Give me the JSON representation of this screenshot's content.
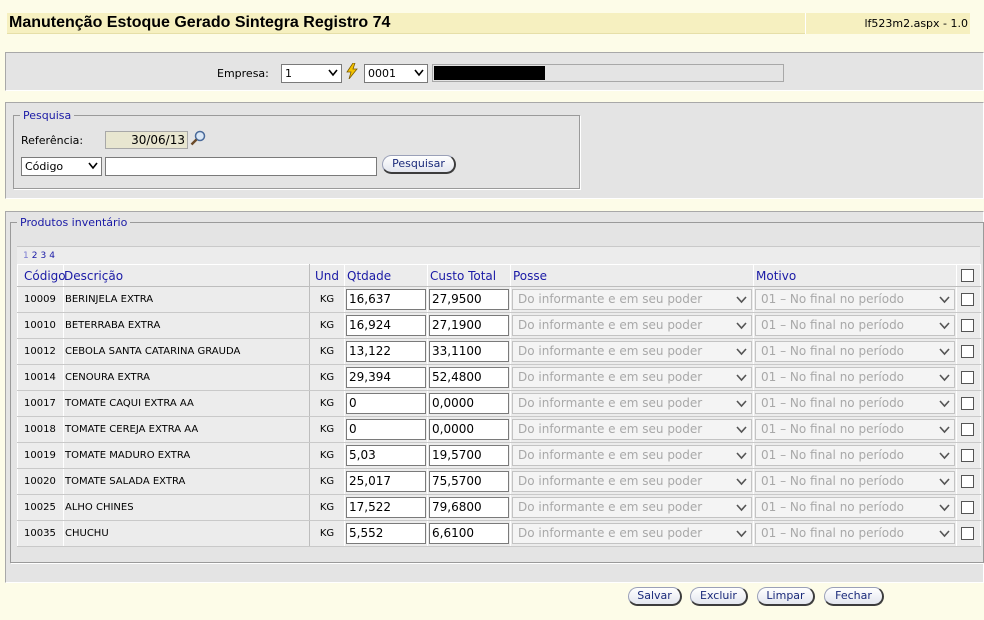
{
  "header": {
    "title": "Manutenção Estoque Gerado Sintegra Registro 74",
    "page_id": "lf523m2.aspx - 1.0"
  },
  "empresa": {
    "label": "Empresa:",
    "select_value": "1",
    "filial_value": "0001"
  },
  "pesquisa": {
    "legend": "Pesquisa",
    "referencia_label": "Referência:",
    "referencia_value": "30/06/13",
    "field_select": "Código",
    "search_value": "",
    "search_button": "Pesquisar"
  },
  "produtos": {
    "legend": "Produtos inventário",
    "pages": [
      "1",
      "2",
      "3",
      "4"
    ],
    "columns": {
      "codigo": "Código",
      "descricao": "Descrição",
      "und": "Und",
      "qtdade": "Qtdade",
      "custo": "Custo Total",
      "posse": "Posse",
      "motivo": "Motivo"
    },
    "rows": [
      {
        "codigo": "10009",
        "descricao": "BERINJELA EXTRA",
        "und": "KG",
        "qtdade": "16,637",
        "custo": "27,9500",
        "posse": "Do informante e em seu poder",
        "motivo": "01 – No final no período"
      },
      {
        "codigo": "10010",
        "descricao": "BETERRABA EXTRA",
        "und": "KG",
        "qtdade": "16,924",
        "custo": "27,1900",
        "posse": "Do informante e em seu poder",
        "motivo": "01 – No final no período"
      },
      {
        "codigo": "10012",
        "descricao": "CEBOLA SANTA CATARINA GRAUDA",
        "und": "KG",
        "qtdade": "13,122",
        "custo": "33,1100",
        "posse": "Do informante e em seu poder",
        "motivo": "01 – No final no período"
      },
      {
        "codigo": "10014",
        "descricao": "CENOURA EXTRA",
        "und": "KG",
        "qtdade": "29,394",
        "custo": "52,4800",
        "posse": "Do informante e em seu poder",
        "motivo": "01 – No final no período"
      },
      {
        "codigo": "10017",
        "descricao": "TOMATE CAQUI EXTRA AA",
        "und": "KG",
        "qtdade": "0",
        "custo": "0,0000",
        "posse": "Do informante e em seu poder",
        "motivo": "01 – No final no período"
      },
      {
        "codigo": "10018",
        "descricao": "TOMATE CEREJA EXTRA AA",
        "und": "KG",
        "qtdade": "0",
        "custo": "0,0000",
        "posse": "Do informante e em seu poder",
        "motivo": "01 – No final no período"
      },
      {
        "codigo": "10019",
        "descricao": "TOMATE MADURO EXTRA",
        "und": "KG",
        "qtdade": "5,03",
        "custo": "19,5700",
        "posse": "Do informante e em seu poder",
        "motivo": "01 – No final no período"
      },
      {
        "codigo": "10020",
        "descricao": "TOMATE SALADA EXTRA",
        "und": "KG",
        "qtdade": "25,017",
        "custo": "75,5700",
        "posse": "Do informante e em seu poder",
        "motivo": "01 – No final no período"
      },
      {
        "codigo": "10025",
        "descricao": "ALHO CHINES",
        "und": "KG",
        "qtdade": "17,522",
        "custo": "79,6800",
        "posse": "Do informante e em seu poder",
        "motivo": "01 – No final no período"
      },
      {
        "codigo": "10035",
        "descricao": "CHUCHU",
        "und": "KG",
        "qtdade": "5,552",
        "custo": "6,6100",
        "posse": "Do informante e em seu poder",
        "motivo": "01 – No final no período"
      }
    ]
  },
  "actions": {
    "salvar": "Salvar",
    "excluir": "Excluir",
    "limpar": "Limpar",
    "fechar": "Fechar"
  },
  "colors": {
    "background": "#fdfce8",
    "title_bar": "#f6f0c0",
    "panel": "#e4e4e4",
    "link": "#1a1aa6"
  },
  "icons": [
    "chevron-down-icon",
    "lightning-icon",
    "magnifier-icon"
  ]
}
